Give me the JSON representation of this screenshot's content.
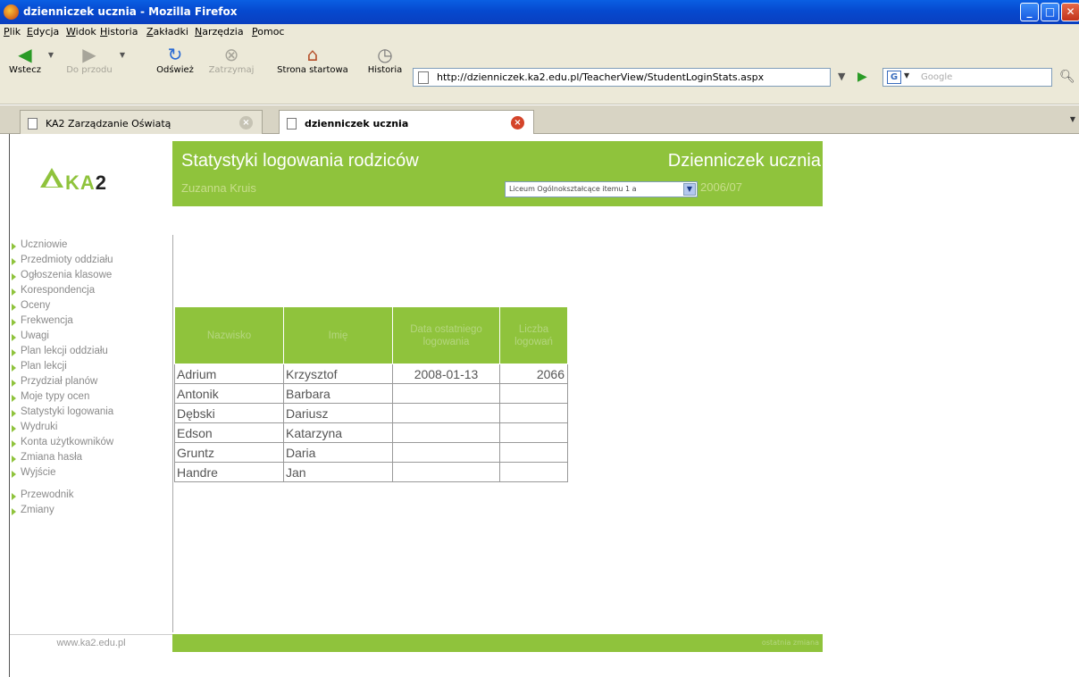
{
  "window": {
    "title": "dzienniczek ucznia - Mozilla Firefox"
  },
  "menu": [
    "Plik",
    "Edycja",
    "Widok",
    "Historia",
    "Zakładki",
    "Narzędzia",
    "Pomoc"
  ],
  "nav": {
    "back": "Wstecz",
    "forward": "Do przodu",
    "reload": "Odśwież",
    "stop": "Zatrzymaj",
    "home": "Strona startowa",
    "history": "Historia"
  },
  "url": "http://dzienniczek.ka2.edu.pl/TeacherView/StudentLoginStats.aspx",
  "search": {
    "placeholder": "Google"
  },
  "tabs": [
    {
      "label": "KA2 Zarządzanie Oświatą"
    },
    {
      "label": "dzienniczek ucznia"
    }
  ],
  "header": {
    "logo_text_1": "KA",
    "logo_text_2": "2",
    "page_title": "Statystyki logowania rodziców",
    "app_title": "Dzienniczek ucznia",
    "user_name": "Zuzanna Kruis",
    "class_select": "Liceum Ogólnokształcące itemu 1 a",
    "school_year": "2006/07"
  },
  "sidebar": {
    "group1": [
      "Uczniowie",
      "Przedmioty oddziału",
      "Ogłoszenia klasowe",
      "Korespondencja",
      "Oceny",
      "Frekwencja",
      "Uwagi",
      "Plan lekcji oddziału",
      "Plan lekcji",
      "Przydział planów",
      "Moje typy ocen",
      "Statystyki logowania",
      "Wydruki",
      "Konta użytkowników",
      "Zmiana hasła",
      "Wyjście"
    ],
    "group2": [
      "Przewodnik",
      "Zmiany"
    ]
  },
  "table": {
    "headers": [
      "Nazwisko",
      "Imię",
      "Data ostatniego logowania",
      "Liczba logowań"
    ],
    "rows": [
      [
        "Adrium",
        "Krzysztof",
        "2008-01-13",
        "2066"
      ],
      [
        "Antonik",
        "Barbara",
        "",
        ""
      ],
      [
        "Dębski",
        "Dariusz",
        "",
        ""
      ],
      [
        "Edson",
        "Katarzyna",
        "",
        ""
      ],
      [
        "Gruntz",
        "Daria",
        "",
        ""
      ],
      [
        "Handre",
        "Jan",
        "",
        ""
      ]
    ]
  },
  "footer": {
    "url": "www.ka2.edu.pl",
    "note": "ostatnia zmiana"
  }
}
